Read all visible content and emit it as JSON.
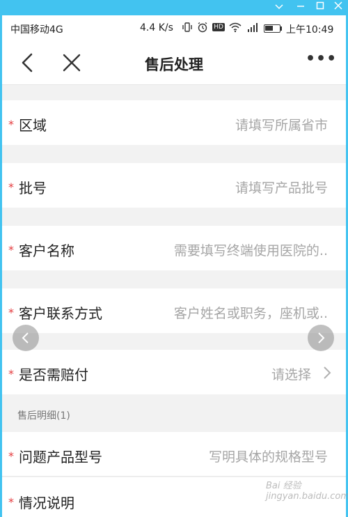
{
  "status": {
    "carrier": "中国移动4G",
    "speed": "4.4 K/s",
    "icons": [
      "vibrate-icon",
      "alarm-icon",
      "hd-icon",
      "wifi-icon",
      "signal-icon",
      "battery-icon"
    ],
    "hd_label": "HD",
    "time": "上午10:49"
  },
  "nav": {
    "title": "售后处理",
    "more_label": "•••"
  },
  "fields": [
    {
      "label": "区域",
      "placeholder": "请填写所属省市"
    },
    {
      "label": "批号",
      "placeholder": "请填写产品批号"
    },
    {
      "label": "客户名称",
      "placeholder": "需要填写终端使用医院的.."
    },
    {
      "label": "客户联系方式",
      "placeholder": "客户姓名或职务，座机或.."
    },
    {
      "label": "是否需赔付",
      "placeholder": "请选择"
    }
  ],
  "section": {
    "title": "售后明细(1)"
  },
  "detail_fields": [
    {
      "label": "问题产品型号",
      "placeholder": "写明具体的规格型号"
    },
    {
      "label": "情况说明",
      "placeholder": ""
    }
  ],
  "required_mark": "*",
  "watermark": "Bai 经验 jingyan.baidu.com",
  "colors": {
    "window_frame": "#42c3f0",
    "required": "#e4393c",
    "placeholder": "#a6a6a6"
  }
}
